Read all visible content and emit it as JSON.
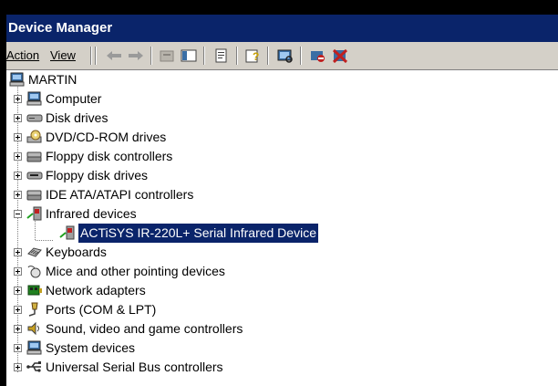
{
  "window": {
    "title": "Device Manager"
  },
  "menu": {
    "action": "Action",
    "view": "View"
  },
  "tree": {
    "root": "MARTIN",
    "categories": [
      {
        "label": "Computer",
        "icon": "computer-icon",
        "expanded": false
      },
      {
        "label": "Disk drives",
        "icon": "disk-drive-icon",
        "expanded": false
      },
      {
        "label": "DVD/CD-ROM drives",
        "icon": "cdrom-icon",
        "expanded": false
      },
      {
        "label": "Floppy disk controllers",
        "icon": "controller-icon",
        "expanded": false
      },
      {
        "label": "Floppy disk drives",
        "icon": "floppy-drive-icon",
        "expanded": false
      },
      {
        "label": "IDE ATA/ATAPI controllers",
        "icon": "controller-icon",
        "expanded": false
      },
      {
        "label": "Infrared devices",
        "icon": "infrared-icon",
        "expanded": true,
        "children": [
          {
            "label": "ACTiSYS IR-220L+ Serial Infrared Device",
            "selected": true
          }
        ]
      },
      {
        "label": "Keyboards",
        "icon": "keyboard-icon",
        "expanded": false
      },
      {
        "label": "Mice and other pointing devices",
        "icon": "mouse-icon",
        "expanded": false
      },
      {
        "label": "Network adapters",
        "icon": "network-adapter-icon",
        "expanded": false
      },
      {
        "label": "Ports (COM & LPT)",
        "icon": "port-icon",
        "expanded": false
      },
      {
        "label": "Sound, video and game controllers",
        "icon": "sound-icon",
        "expanded": false
      },
      {
        "label": "System devices",
        "icon": "system-icon",
        "expanded": false
      },
      {
        "label": "Universal Serial Bus controllers",
        "icon": "usb-icon",
        "expanded": false
      }
    ]
  },
  "colors": {
    "titlebar": "#0a246a",
    "selection": "#0a246a",
    "face": "#d4d0c8"
  }
}
